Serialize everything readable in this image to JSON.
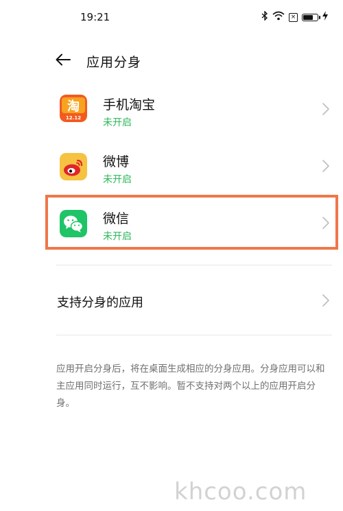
{
  "status_bar": {
    "time": "19:21",
    "icons": [
      "bluetooth-icon",
      "wifi-icon",
      "close-box-icon",
      "battery-icon",
      "charging-icon"
    ],
    "battery_level": 0.8
  },
  "header": {
    "back_icon": "arrow-left-icon",
    "title": "应用分身"
  },
  "apps": [
    {
      "name": "手机淘宝",
      "status": "未开启",
      "icon": "taobao-icon",
      "icon_text": "淘",
      "icon_subtext": "12.12"
    },
    {
      "name": "微博",
      "status": "未开启",
      "icon": "weibo-icon"
    },
    {
      "name": "微信",
      "status": "未开启",
      "icon": "wechat-icon"
    }
  ],
  "support_row": {
    "label": "支持分身的应用"
  },
  "description": "应用开启分身后，将在桌面生成相应的分身应用。分身应用可以和主应用同时运行，互不影响。暂不支持对两个以上的应用开启分身。",
  "watermark": "khcoo.com",
  "colors": {
    "status_green": "#2DB85B",
    "highlight_border": "#F07649",
    "taobao_orange": "#F25B1F",
    "weibo_red": "#E0252A",
    "weibo_yellow": "#F5C242",
    "wechat_green": "#1FC467",
    "chevron": "#bdbdbd"
  }
}
